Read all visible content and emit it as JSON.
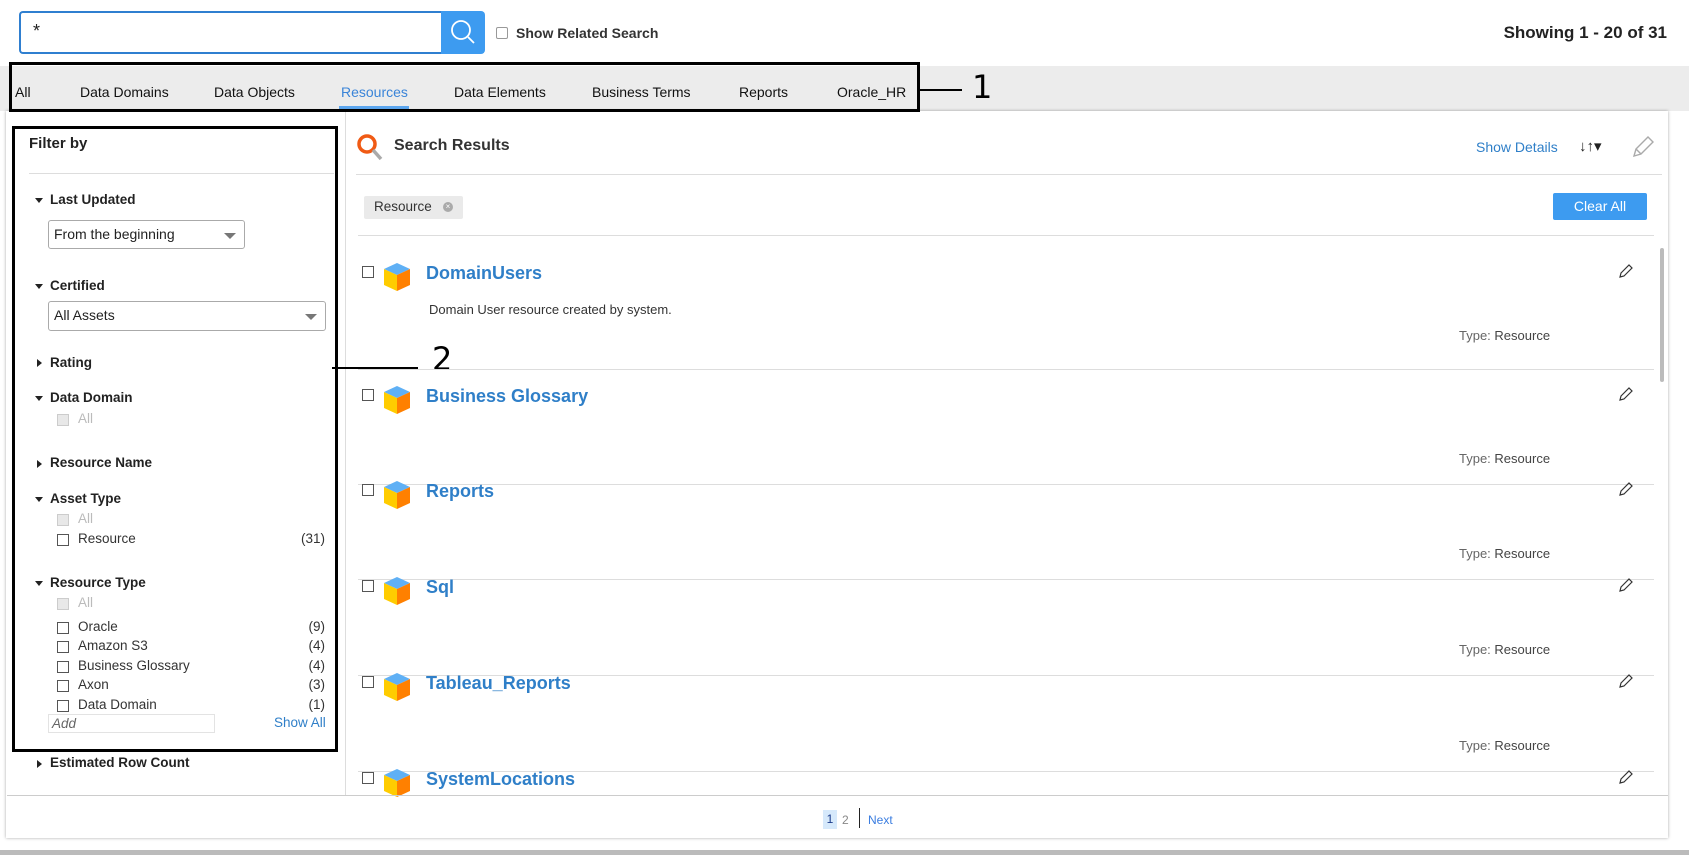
{
  "search": {
    "value": "*",
    "related_label": "Show Related Search",
    "showing": "Showing 1 - 20 of 31"
  },
  "tabs": [
    {
      "label": "All"
    },
    {
      "label": "Data Domains"
    },
    {
      "label": "Data Objects"
    },
    {
      "label": "Resources",
      "active": true
    },
    {
      "label": "Data Elements"
    },
    {
      "label": "Business Terms"
    },
    {
      "label": "Reports"
    },
    {
      "label": "Oracle_HR"
    }
  ],
  "annotations": {
    "one": "1",
    "two": "2"
  },
  "filter": {
    "title": "Filter by",
    "last_updated": {
      "label": "Last Updated",
      "value": "From the beginning"
    },
    "certified": {
      "label": "Certified",
      "value": "All Assets"
    },
    "rating": "Rating",
    "data_domain": {
      "label": "Data Domain",
      "all": "All"
    },
    "resource_name": "Resource Name",
    "asset_type": {
      "label": "Asset Type",
      "all": "All",
      "items": [
        {
          "label": "Resource",
          "count": "(31)"
        }
      ]
    },
    "resource_type": {
      "label": "Resource Type",
      "all": "All",
      "items": [
        {
          "label": "Oracle",
          "count": "(9)"
        },
        {
          "label": "Amazon S3",
          "count": "(4)"
        },
        {
          "label": "Business Glossary",
          "count": "(4)"
        },
        {
          "label": "Axon",
          "count": "(3)"
        },
        {
          "label": "Data Domain",
          "count": "(1)"
        }
      ],
      "add_placeholder": "Add",
      "show_all": "Show All"
    },
    "estimated_row_count": "Estimated Row Count"
  },
  "results": {
    "title": "Search Results",
    "show_details": "Show Details",
    "chip": "Resource",
    "clear_all": "Clear All",
    "type_label": "Type:",
    "items": [
      {
        "name": "DomainUsers",
        "description": "Domain User resource created by system.",
        "type": "Resource"
      },
      {
        "name": "Business Glossary",
        "description": "",
        "type": "Resource"
      },
      {
        "name": "Reports",
        "description": "",
        "type": "Resource"
      },
      {
        "name": "Sql",
        "description": "",
        "type": "Resource"
      },
      {
        "name": "Tableau_Reports",
        "description": "",
        "type": "Resource"
      },
      {
        "name": "SystemLocations",
        "description": "",
        "type": ""
      }
    ]
  },
  "pagination": {
    "pages": [
      "1",
      "2"
    ],
    "current": "1",
    "next": "Next"
  },
  "colors": {
    "accent": "#3d9bf0",
    "link": "#2f7fc8",
    "cube_top": "#5fb0f5",
    "cube_left": "#ffcc00",
    "cube_right": "#ff8000"
  }
}
